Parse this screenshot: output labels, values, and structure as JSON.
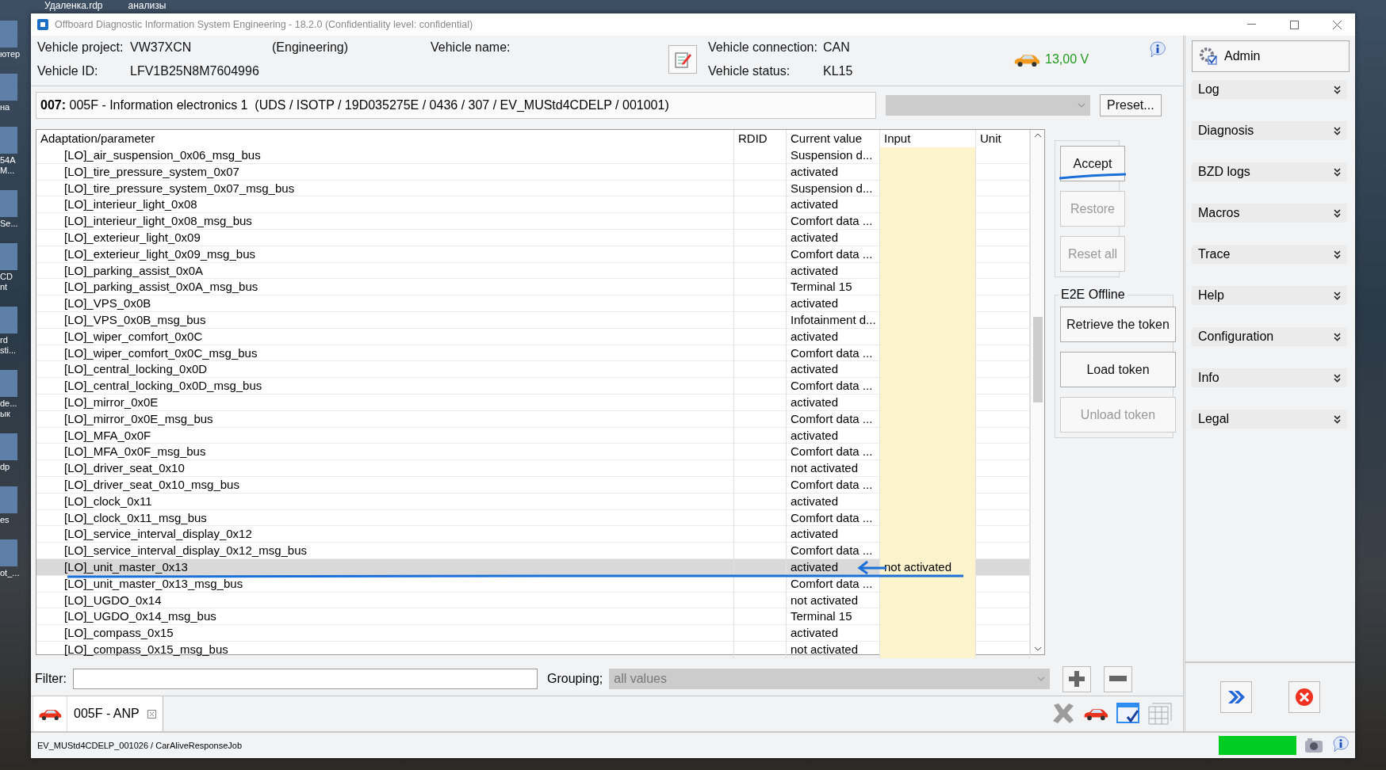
{
  "desktop": {
    "top_labels": [
      "Удаленка.rdp",
      "анализы"
    ],
    "icons": [
      {
        "lines": [
          "ютер"
        ]
      },
      {
        "lines": [
          "на"
        ]
      },
      {
        "lines": [
          "54A",
          "M..."
        ]
      },
      {
        "lines": [
          "Se..."
        ]
      },
      {
        "lines": [
          "CD",
          "nt"
        ]
      },
      {
        "lines": [
          "rd",
          "sti..."
        ]
      },
      {
        "lines": [
          "de...",
          "ык"
        ]
      },
      {
        "lines": [
          "dp"
        ]
      },
      {
        "lines": [
          "es"
        ]
      },
      {
        "lines": [
          "ot_..."
        ]
      }
    ]
  },
  "window": {
    "title": "Offboard Diagnostic Information System Engineering - 18.2.0 (Confidentiality level: confidential)"
  },
  "vehicle": {
    "project_label": "Vehicle project:",
    "project": "VW37XCN",
    "mode": "(Engineering)",
    "name_label": "Vehicle name:",
    "id_label": "Vehicle ID:",
    "id": "LFV1B25N8M7604996",
    "connection_label": "Vehicle connection:",
    "connection": "CAN",
    "status_label": "Vehicle status:",
    "status": "KL15",
    "voltage": "13,00 V"
  },
  "ecu": {
    "text": "**007:** 005F - Information electronics 1  (UDS / ISOTP / 19D035275E / 0436 / 307 / EV_MUStd4CDELP / 001001)",
    "selector_disabled": true,
    "preset_button": "Preset..."
  },
  "table": {
    "columns": [
      "Adaptation/parameter",
      "RDID",
      "Current value",
      "Input",
      "Unit"
    ],
    "rows": [
      {
        "parameter": "[LO]_air_suspension_0x06_msg_bus",
        "current": "Suspension d...",
        "selected": false
      },
      {
        "parameter": "[LO]_tire_pressure_system_0x07",
        "current": "activated",
        "selected": false
      },
      {
        "parameter": "[LO]_tire_pressure_system_0x07_msg_bus",
        "current": "Suspension d...",
        "selected": false
      },
      {
        "parameter": "[LO]_interieur_light_0x08",
        "current": "activated",
        "selected": false
      },
      {
        "parameter": "[LO]_interieur_light_0x08_msg_bus",
        "current": "Comfort data ...",
        "selected": false
      },
      {
        "parameter": "[LO]_exterieur_light_0x09",
        "current": "activated",
        "selected": false
      },
      {
        "parameter": "[LO]_exterieur_light_0x09_msg_bus",
        "current": "Comfort data ...",
        "selected": false
      },
      {
        "parameter": "[LO]_parking_assist_0x0A",
        "current": "activated",
        "selected": false
      },
      {
        "parameter": "[LO]_parking_assist_0x0A_msg_bus",
        "current": "Terminal 15",
        "selected": false
      },
      {
        "parameter": "[LO]_VPS_0x0B",
        "current": "activated",
        "selected": false
      },
      {
        "parameter": "[LO]_VPS_0x0B_msg_bus",
        "current": "Infotainment d...",
        "selected": false
      },
      {
        "parameter": "[LO]_wiper_comfort_0x0C",
        "current": "activated",
        "selected": false
      },
      {
        "parameter": "[LO]_wiper_comfort_0x0C_msg_bus",
        "current": "Comfort data ...",
        "selected": false
      },
      {
        "parameter": "[LO]_central_locking_0x0D",
        "current": "activated",
        "selected": false
      },
      {
        "parameter": "[LO]_central_locking_0x0D_msg_bus",
        "current": "Comfort data ...",
        "selected": false
      },
      {
        "parameter": "[LO]_mirror_0x0E",
        "current": "activated",
        "selected": false
      },
      {
        "parameter": "[LO]_mirror_0x0E_msg_bus",
        "current": "Comfort data ...",
        "selected": false
      },
      {
        "parameter": "[LO]_MFA_0x0F",
        "current": "activated",
        "selected": false
      },
      {
        "parameter": "[LO]_MFA_0x0F_msg_bus",
        "current": "Comfort data ...",
        "selected": false
      },
      {
        "parameter": "[LO]_driver_seat_0x10",
        "current": "not activated",
        "selected": false
      },
      {
        "parameter": "[LO]_driver_seat_0x10_msg_bus",
        "current": "Comfort data ...",
        "selected": false
      },
      {
        "parameter": "[LO]_clock_0x11",
        "current": "activated",
        "selected": false
      },
      {
        "parameter": "[LO]_clock_0x11_msg_bus",
        "current": "Comfort data ...",
        "selected": false
      },
      {
        "parameter": "[LO]_service_interval_display_0x12",
        "current": "activated",
        "selected": false
      },
      {
        "parameter": "[LO]_service_interval_display_0x12_msg_bus",
        "current": "Comfort data ...",
        "selected": false
      },
      {
        "parameter": "[LO]_unit_master_0x13",
        "current": "activated",
        "input": "not activated",
        "selected": true
      },
      {
        "parameter": "[LO]_unit_master_0x13_msg_bus",
        "current": "Comfort data ...",
        "selected": false
      },
      {
        "parameter": "[LO]_UGDO_0x14",
        "current": "not activated",
        "selected": false
      },
      {
        "parameter": "[LO]_UGDO_0x14_msg_bus",
        "current": "Terminal 15",
        "selected": false
      },
      {
        "parameter": "[LO]_compass_0x15",
        "current": "activated",
        "selected": false
      },
      {
        "parameter": "[LO]_compass_0x15_msg_bus",
        "current": "not activated",
        "selected": false
      }
    ]
  },
  "actions": [
    {
      "label": "Accept",
      "disabled": false
    },
    {
      "label": "Restore",
      "disabled": true
    },
    {
      "label": "Reset all",
      "disabled": true
    }
  ],
  "e2e": {
    "title": "E2E Offline",
    "buttons": [
      {
        "label": "Retrieve the token",
        "disabled": false
      },
      {
        "label": "Load token",
        "disabled": false
      },
      {
        "label": "Unload token",
        "disabled": true
      }
    ]
  },
  "filter": {
    "label": "Filter:"
  },
  "grouping": {
    "label": "Grouping;",
    "value": "all values",
    "disabled": true
  },
  "tabs": [
    {
      "label": "005F - ANP",
      "selected": true
    }
  ],
  "sidebar": {
    "user": "Admin",
    "items": [
      {
        "label": "Log"
      },
      {
        "label": "Diagnosis"
      },
      {
        "label": "BZD logs"
      },
      {
        "label": "Macros"
      },
      {
        "label": "Trace"
      },
      {
        "label": "Help"
      },
      {
        "label": "Configuration"
      },
      {
        "label": "Info"
      },
      {
        "label": "Legal"
      }
    ]
  },
  "status_bar": {
    "text": "EV_MUStd4CDELP_001026 / CarAliveResponseJob"
  }
}
